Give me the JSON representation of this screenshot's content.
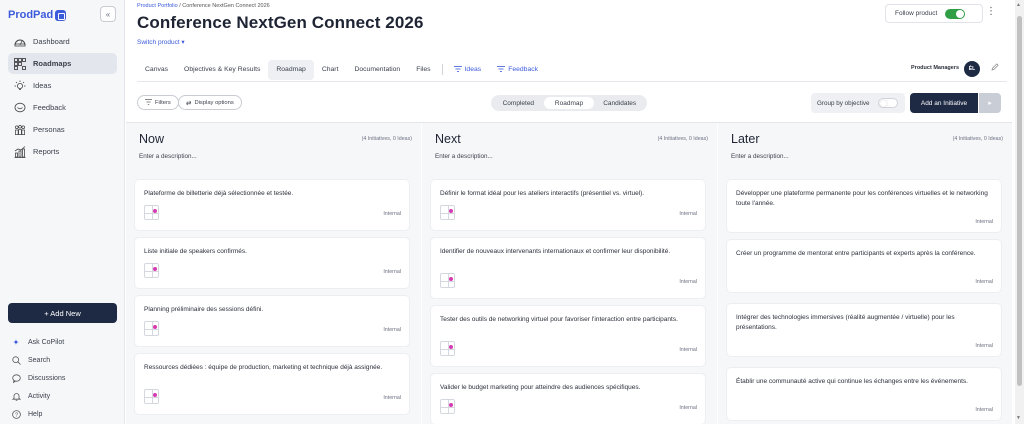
{
  "sidebar": {
    "logo": "ProdPad",
    "collapse_glyph": "«",
    "items": [
      {
        "label": "Dashboard",
        "icon": "dashboard-icon",
        "active": false
      },
      {
        "label": "Roadmaps",
        "icon": "roadmap-icon",
        "active": true
      },
      {
        "label": "Ideas",
        "icon": "lightbulb-icon",
        "active": false
      },
      {
        "label": "Feedback",
        "icon": "feedback-icon",
        "active": false
      },
      {
        "label": "Personas",
        "icon": "personas-icon",
        "active": false
      },
      {
        "label": "Reports",
        "icon": "reports-icon",
        "active": false
      }
    ],
    "add_new": "+ Add New",
    "bottom_items": [
      {
        "label": "Ask CoPilot",
        "icon": "sparkle-icon"
      },
      {
        "label": "Search",
        "icon": "search-icon"
      },
      {
        "label": "Discussions",
        "icon": "chat-icon"
      },
      {
        "label": "Activity",
        "icon": "bell-icon"
      },
      {
        "label": "Help",
        "icon": "help-icon"
      }
    ]
  },
  "header": {
    "breadcrumb_link": "Product Portfolio",
    "breadcrumb_sep": " / ",
    "breadcrumb_current": "Conference NextGen Connect 2026",
    "title": "Conference NextGen Connect 2026",
    "switch_product": "Switch product ▾",
    "follow_label": "Follow product",
    "follow_on": true,
    "more": "⋮"
  },
  "tabs": [
    {
      "label": "Canvas",
      "active": false
    },
    {
      "label": "Objectives & Key Results",
      "active": false
    },
    {
      "label": "Roadmap",
      "active": true
    },
    {
      "label": "Chart",
      "active": false
    },
    {
      "label": "Documentation",
      "active": false
    },
    {
      "label": "Files",
      "active": false
    },
    {
      "label": "Ideas",
      "active": false,
      "filter": true
    },
    {
      "label": "Feedback",
      "active": false,
      "filter": true
    }
  ],
  "product_managers": {
    "label": "Product Managers",
    "initials": "ÉL"
  },
  "toolbar": {
    "filters": "Filters",
    "display_options": "Display options",
    "segments": [
      {
        "label": "Completed",
        "active": false
      },
      {
        "label": "Roadmap",
        "active": true
      },
      {
        "label": "Candidates",
        "active": false
      }
    ],
    "group_by": "Group by objective",
    "add_initiative": "Add an Initiative",
    "add_arrow": "▸"
  },
  "columns": [
    {
      "title": "Now",
      "count": "(4 Initiatives, 0 Ideas)",
      "description": "Enter a description...",
      "cards": [
        {
          "title": "Plateforme de billetterie déjà sélectionnée et testée.",
          "tag": "Internal"
        },
        {
          "title": "Liste initiale de speakers confirmés.",
          "tag": "Internal"
        },
        {
          "title": "Planning préliminaire des sessions défini.",
          "tag": "Internal"
        },
        {
          "title": "Ressources dédiées : équipe de production, marketing et technique déjà assignée.",
          "tag": "Internal"
        }
      ]
    },
    {
      "title": "Next",
      "count": "(4 Initiatives, 0 Ideas)",
      "description": "Enter a description...",
      "cards": [
        {
          "title": "Définir le format idéal pour les ateliers interactifs (présentiel vs. virtuel).",
          "tag": "Internal"
        },
        {
          "title": "Identifier de nouveaux intervenants internationaux et confirmer leur disponibilité.",
          "tag": "Internal"
        },
        {
          "title": "Tester des outils de networking virtuel pour favoriser l'interaction entre participants.",
          "tag": "Internal"
        },
        {
          "title": "Valider le budget marketing pour atteindre des audiences spécifiques.",
          "tag": "Internal"
        }
      ]
    },
    {
      "title": "Later",
      "count": "(4 Initiatives, 0 Ideas)",
      "description": "Enter a description...",
      "cards": [
        {
          "title": "Développer une plateforme permanente pour les conférences virtuelles et le networking toute l'année.",
          "tag": "Internal"
        },
        {
          "title": "Créer un programme de mentorat entre participants et experts après la conférence.",
          "tag": "Internal"
        },
        {
          "title": "Intégrer des technologies immersives (réalité augmentée / virtuelle) pour les présentations.",
          "tag": "Internal"
        },
        {
          "title": "Établir une communauté active qui continue les échanges entre les événements.",
          "tag": "Internal"
        }
      ]
    }
  ],
  "colors": {
    "brand": "#3b5bdb",
    "navy": "#1e2a44",
    "toggle_on": "#2f9e44",
    "idea_dot": "#d63bb0"
  }
}
